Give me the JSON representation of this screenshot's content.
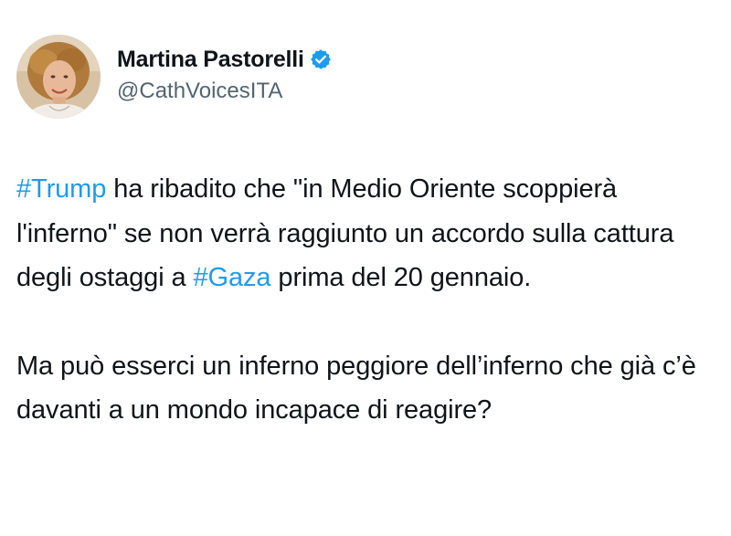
{
  "author": {
    "display_name": "Martina Pastorelli",
    "handle": "@CathVoicesITA",
    "verified_icon": "verified-badge-icon",
    "verified_color": "#1d9bf0"
  },
  "tweet": {
    "p1": {
      "hashtag1": "#Trump",
      "text1": " ha ribadito che \"in Medio Oriente scoppierà l'inferno\" se non verrà raggiunto un accordo sulla cattura degli ostaggi a ",
      "hashtag2": "#Gaza",
      "text2": " prima del 20 gennaio."
    },
    "p2": {
      "text": "Ma può esserci un inferno peggiore dell’inferno che già c’è davanti a un mondo incapace di reagire?"
    }
  },
  "colors": {
    "text": "#0f1419",
    "secondary": "#536471",
    "link": "#1d9bf0"
  }
}
